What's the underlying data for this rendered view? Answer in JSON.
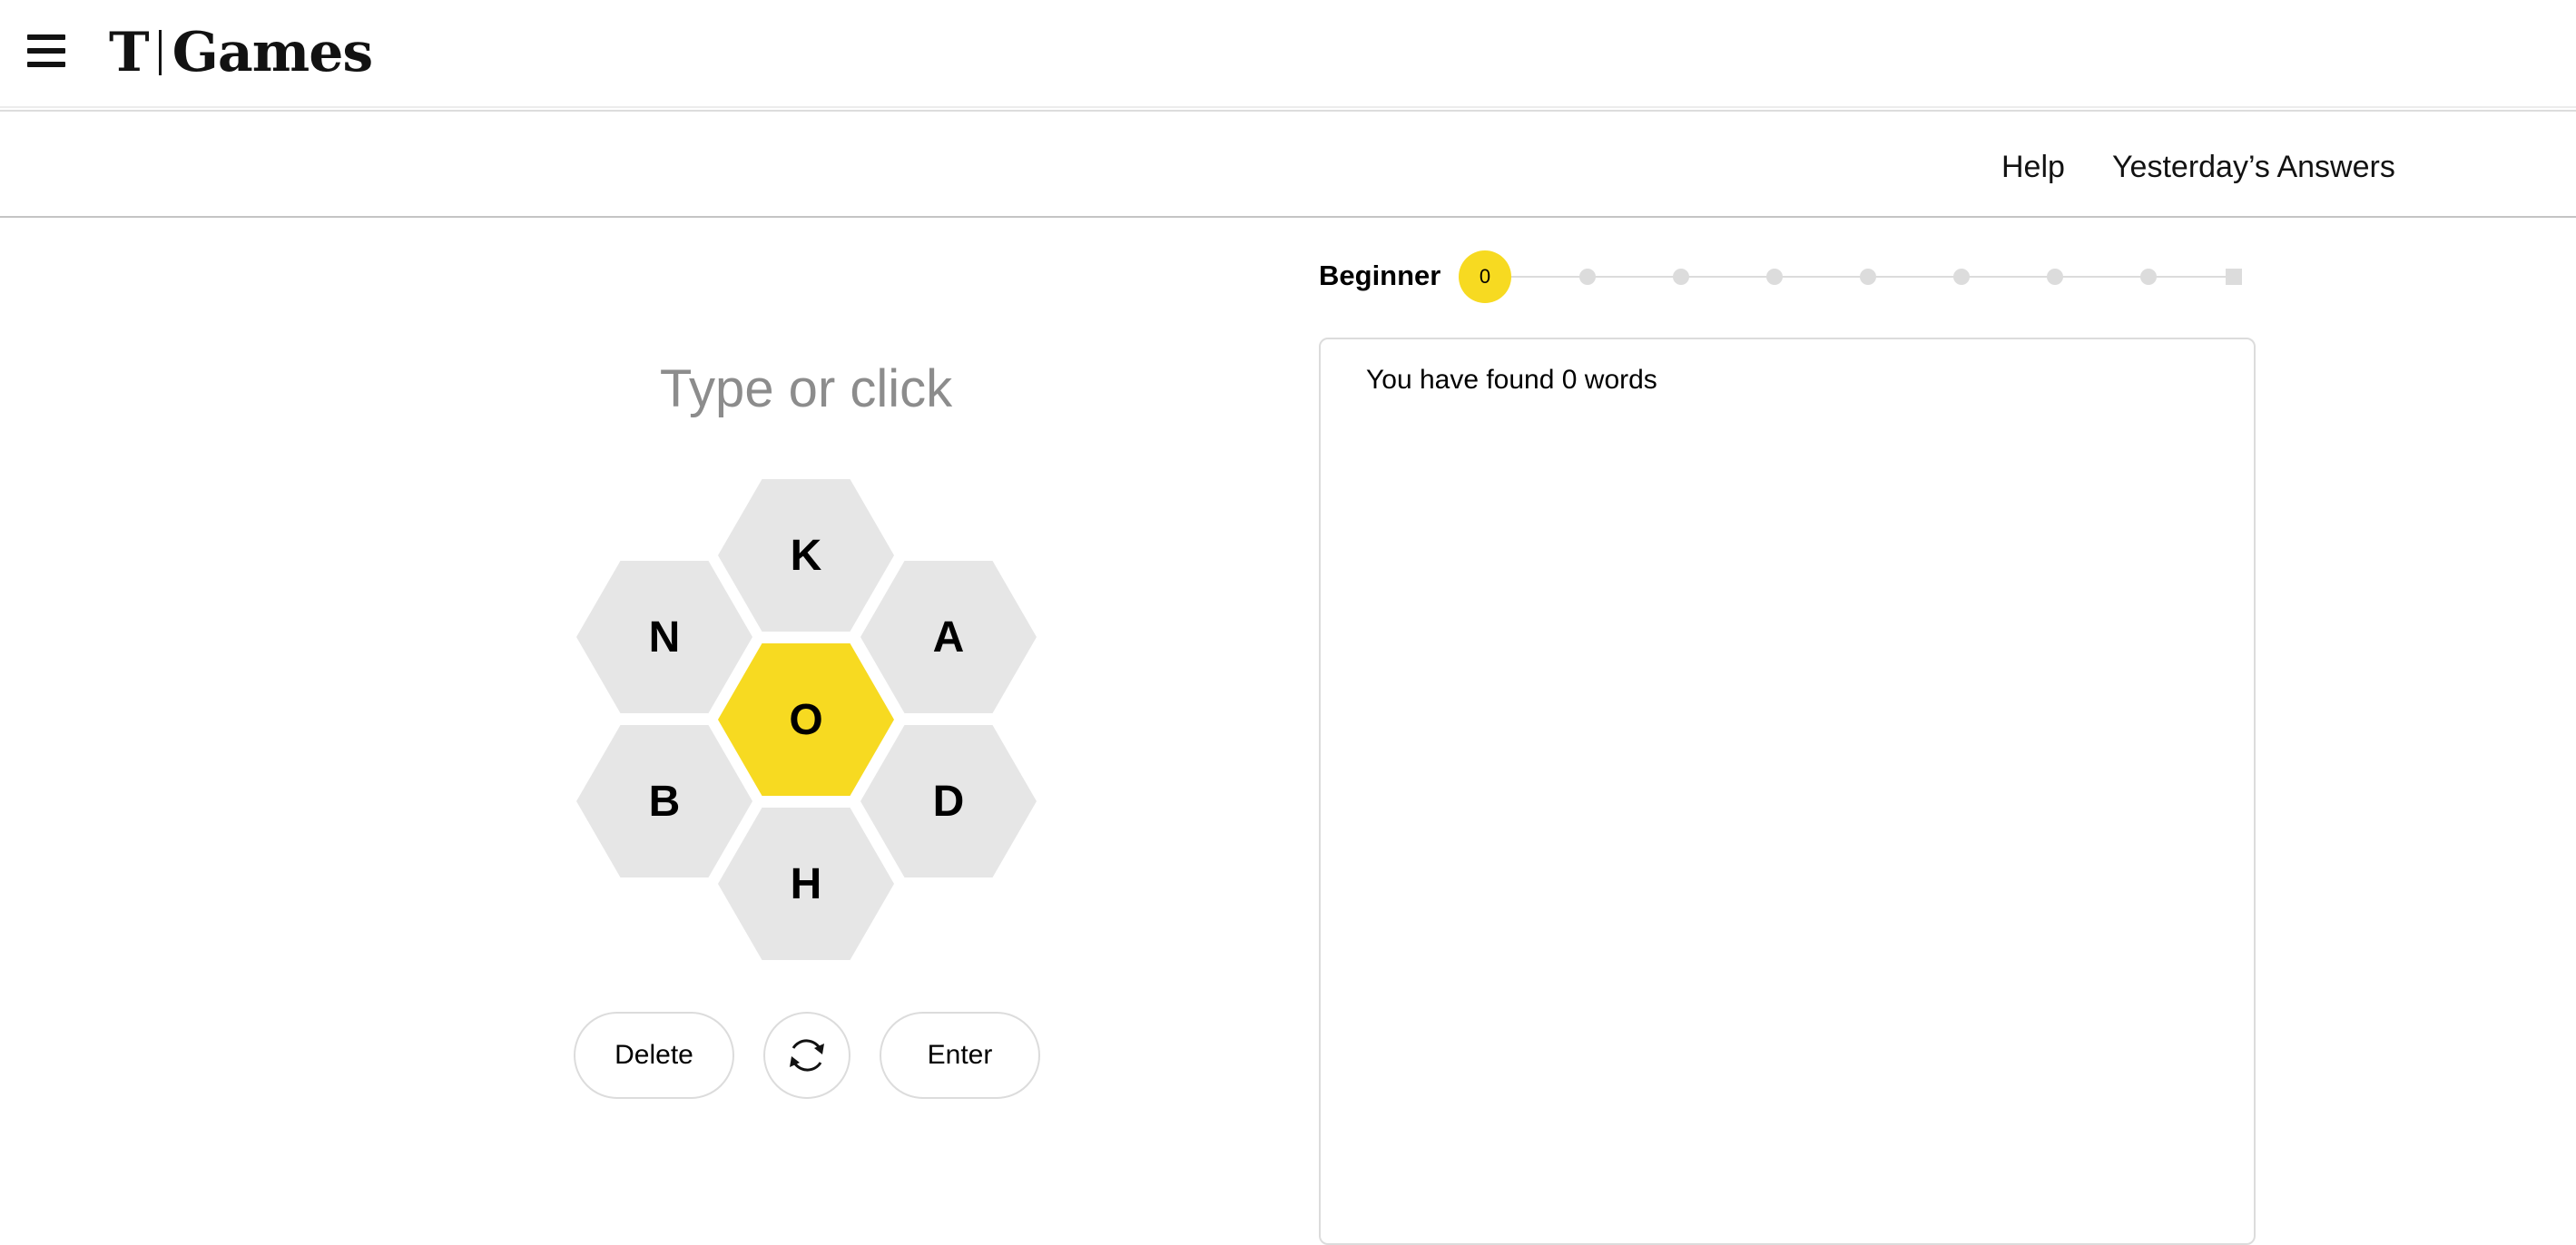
{
  "header": {
    "logo_mark": "T",
    "logo_text": "Games",
    "menu_icon": "hamburger-menu-icon"
  },
  "nav": {
    "help": "Help",
    "yesterday": "Yesterday’s Answers"
  },
  "progress": {
    "rank": "Beginner",
    "score": "0",
    "level_count": 9,
    "current_level": 1
  },
  "input": {
    "placeholder": "Type or click"
  },
  "hive": {
    "center_letter": "O",
    "outer_letters": [
      "K",
      "A",
      "D",
      "H",
      "B",
      "N"
    ]
  },
  "controls": {
    "delete_label": "Delete",
    "shuffle_icon": "shuffle-icon",
    "enter_label": "Enter"
  },
  "word_list": {
    "summary": "You have found 0 words"
  },
  "colors": {
    "accent_yellow": "#f7da21",
    "hex_gray": "#e6e6e6",
    "border_gray": "#dcdcdc",
    "placeholder_gray": "#8c8c8c"
  }
}
